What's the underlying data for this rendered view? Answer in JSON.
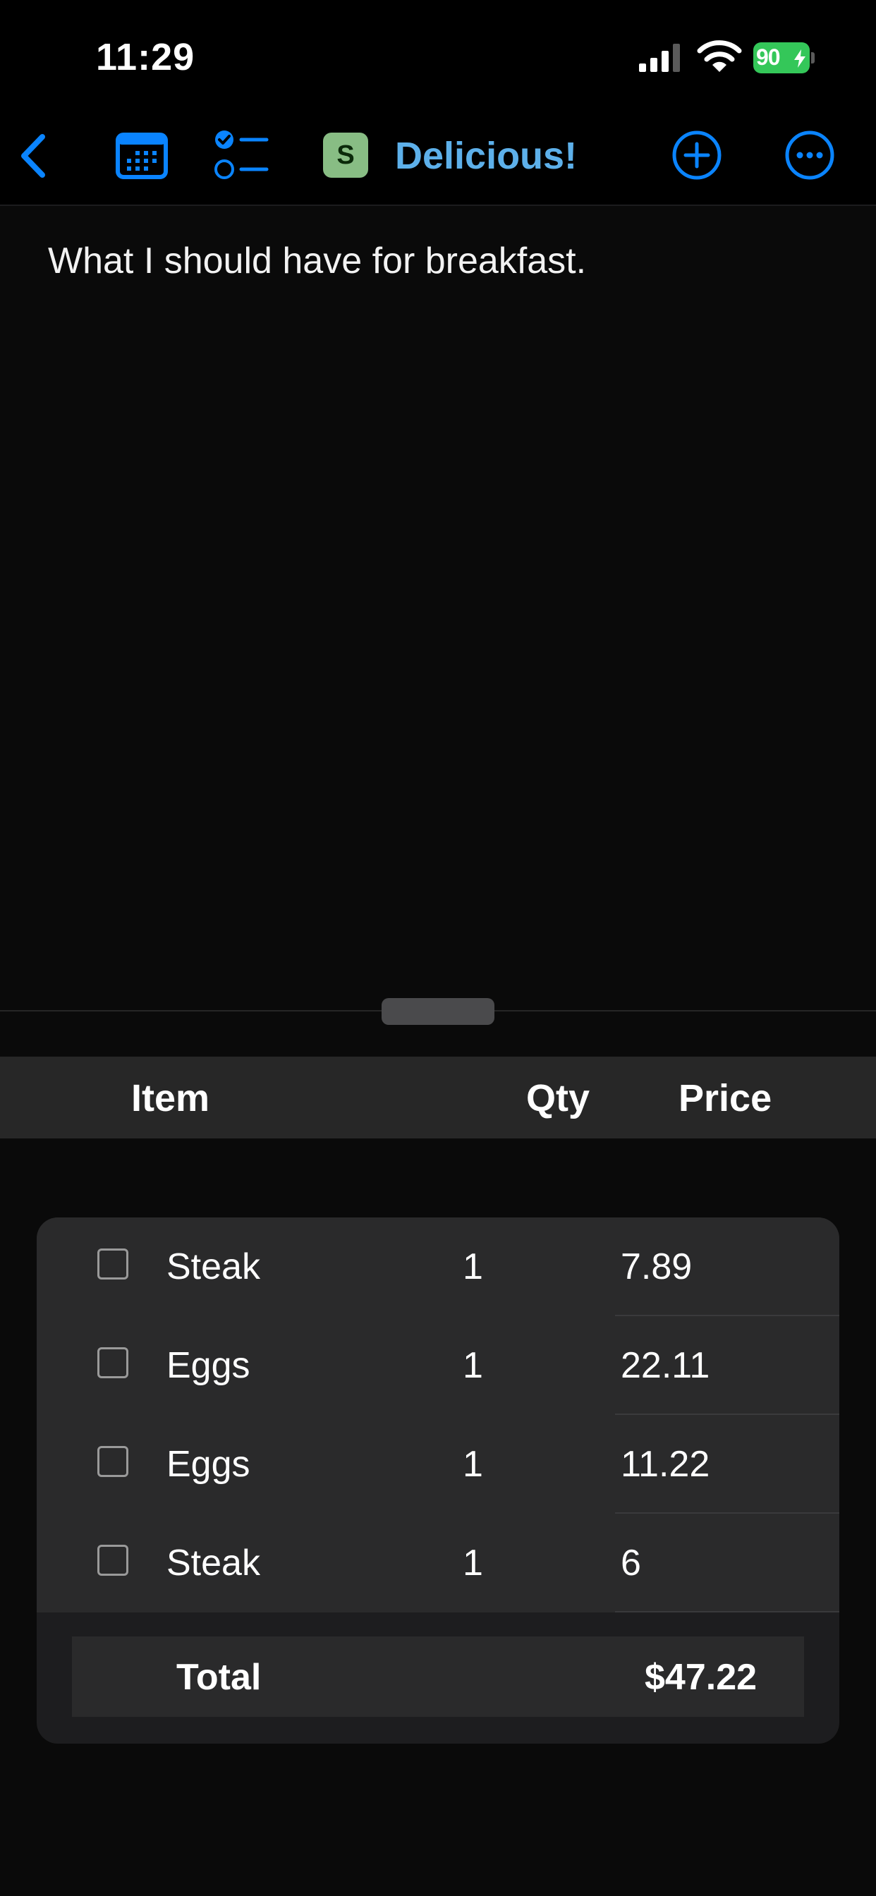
{
  "status_bar": {
    "time": "11:29",
    "battery": "90",
    "icons": [
      "cellular-signal-icon",
      "wifi-icon",
      "battery-charging-icon"
    ],
    "battery_color": "#34c759"
  },
  "toolbar": {
    "title": "Delicious!",
    "badge_letter": "S",
    "badge_color": "#88bd84",
    "accent_color": "#0a84ff",
    "icons": [
      "back-chevron-icon",
      "calendar-icon",
      "checklist-icon",
      "plus-circle-icon",
      "more-ellipsis-icon"
    ]
  },
  "note": {
    "text": "What I should have for breakfast."
  },
  "table": {
    "headers": {
      "item": "Item",
      "qty": "Qty",
      "price": "Price"
    },
    "rows": [
      {
        "item": "Steak",
        "qty": "1",
        "price": "7.89",
        "checked": false
      },
      {
        "item": "Eggs",
        "qty": "1",
        "price": "22.11",
        "checked": false
      },
      {
        "item": "Eggs",
        "qty": "1",
        "price": "11.22",
        "checked": false
      },
      {
        "item": "Steak",
        "qty": "1",
        "price": "6",
        "checked": false
      }
    ],
    "total_label": "Total",
    "total_value": "$47.22"
  }
}
